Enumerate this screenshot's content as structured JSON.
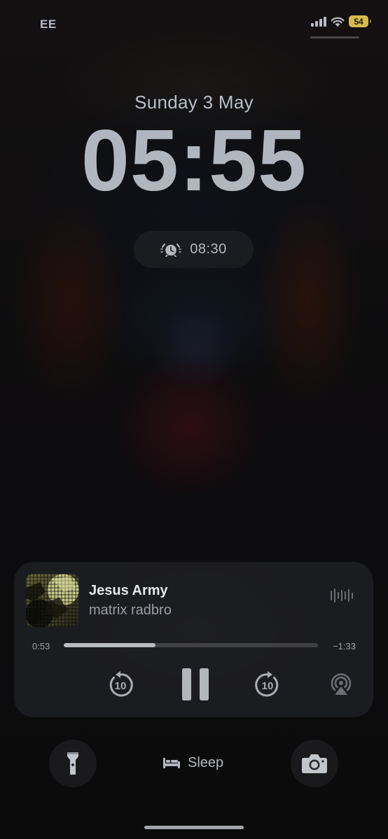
{
  "status_bar": {
    "carrier": "EE",
    "battery_level": "54",
    "battery_color": "#d7b94b",
    "icons": [
      "cellular-signal-icon",
      "wifi-icon",
      "battery-icon"
    ]
  },
  "lock_screen": {
    "date": "Sunday 3 May",
    "time": "05:55"
  },
  "alarm_widget": {
    "icon": "alarm-clock-icon",
    "time": "08:30"
  },
  "now_playing": {
    "title": "Jesus Army",
    "artist": "matrix radbro",
    "elapsed": "0:53",
    "remaining": "−1:33",
    "progress": 0.36,
    "controls": [
      "skip-back-10-icon",
      "pause-icon",
      "skip-forward-10-icon",
      "airplay-icon"
    ],
    "skip_seconds": "10"
  },
  "bottom_bar": {
    "left_icon": "flashlight-icon",
    "focus_label": "Sleep",
    "focus_icon": "bed-icon",
    "right_icon": "camera-icon"
  }
}
